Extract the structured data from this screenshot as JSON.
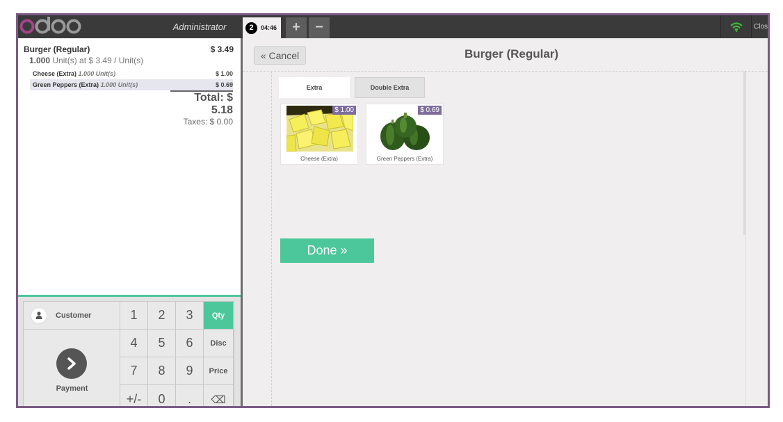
{
  "header": {
    "logo_text": "odoo",
    "user": "Administrator",
    "order_number": "2",
    "order_time": "04:46",
    "add_label": "+",
    "remove_label": "−",
    "close_label": "Clos",
    "wifi_color": "#3dbb3d"
  },
  "order": {
    "product_name": "Burger (Regular)",
    "product_price": "$ 3.49",
    "qty": "1.000",
    "unit_info": "Unit(s) at $ 3.49 / Unit(s)",
    "extras": [
      {
        "name": "Cheese (Extra)",
        "info": "1.000 Unit(s)",
        "price": "$ 1.00"
      },
      {
        "name": "Green Peppers (Extra)",
        "info": "1.000 Unit(s)",
        "price": "$ 0.69"
      }
    ],
    "total": "Total: $ 5.18",
    "taxes": "Taxes: $ 0.00"
  },
  "numpad": {
    "customer_label": "Customer",
    "payment_label": "Payment",
    "keys": [
      "1",
      "2",
      "3",
      "Qty",
      "4",
      "5",
      "6",
      "Disc",
      "7",
      "8",
      "9",
      "Price",
      "+/-",
      "0",
      ".",
      "⌫"
    ]
  },
  "screen": {
    "cancel_label": "« Cancel",
    "title": "Burger (Regular)",
    "tabs": [
      "Extra",
      "Double Extra"
    ],
    "products": [
      {
        "name": "Cheese (Extra)",
        "price": "$ 1.00"
      },
      {
        "name": "Green Peppers (Extra)",
        "price": "$ 0.69"
      }
    ],
    "done_label": "Done »"
  },
  "colors": {
    "accent_green": "#4cc79c",
    "frame_purple": "#7b5c85",
    "badge_purple": "#7f6c9e",
    "header_dark": "#3a3a3a"
  }
}
